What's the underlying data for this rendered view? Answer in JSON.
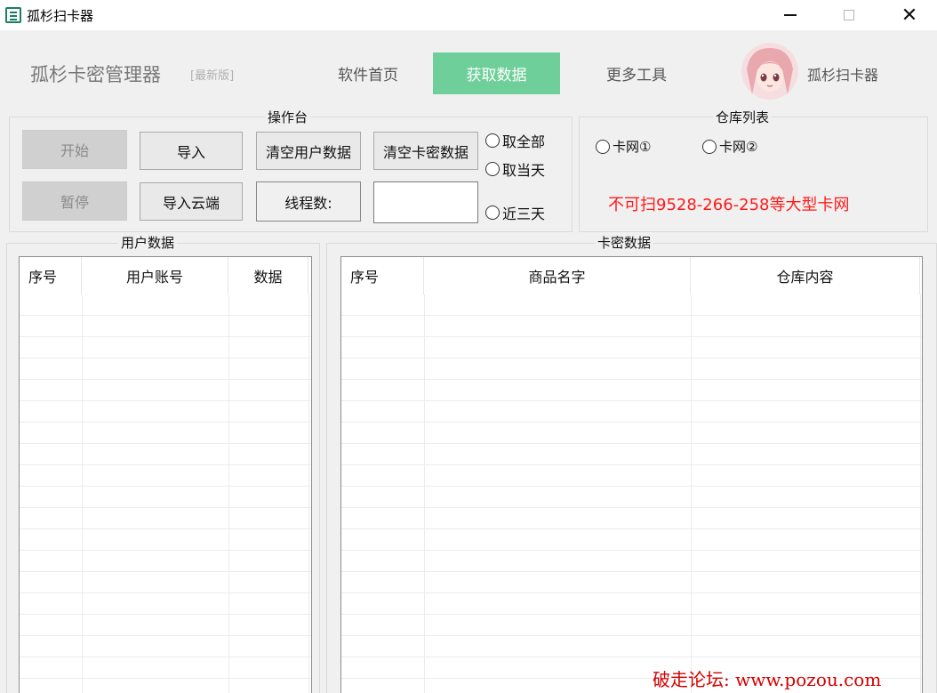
{
  "window": {
    "title": "孤杉扫卡器",
    "minimize_icon": "minimize-icon",
    "maximize_icon": "maximize-icon",
    "close_icon": "close-icon"
  },
  "header": {
    "brand": "孤杉卡密管理器",
    "brand_tag": "[最新版]",
    "nav": [
      {
        "label": "软件首页",
        "active": false
      },
      {
        "label": "获取数据",
        "active": true
      },
      {
        "label": "更多工具",
        "active": false
      }
    ],
    "user_name": "孤杉扫卡器",
    "active_color": "#6fcf9a"
  },
  "console": {
    "title": "操作台",
    "start": "开始",
    "pause": "暂停",
    "import": "导入",
    "import_cloud": "导入云端",
    "clear_user": "清空用户数据",
    "clear_card": "清空卡密数据",
    "thread_label": "线程数:",
    "thread_value": "",
    "options": [
      "取全部",
      "取当天",
      "近三天"
    ]
  },
  "store": {
    "title": "仓库列表",
    "options": [
      "卡网①",
      "卡网②"
    ],
    "warning": "不可扫9528-266-258等大型卡网",
    "warning_color": "#ff1a1a"
  },
  "user_table": {
    "title": "用户数据",
    "columns": [
      "序号",
      "用户账号",
      "数据"
    ],
    "rows": []
  },
  "card_table": {
    "title": "卡密数据",
    "columns": [
      "序号",
      "商品名字",
      "仓库内容"
    ],
    "rows": []
  },
  "watermark": "破走论坛: www.pozou.com"
}
